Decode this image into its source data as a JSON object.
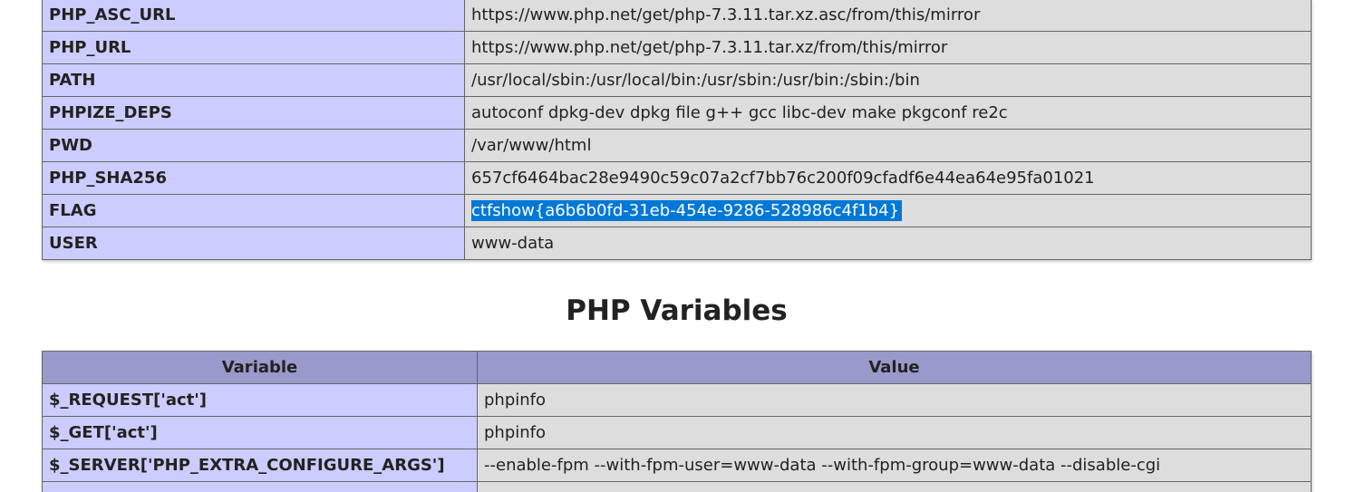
{
  "environment": {
    "rows": [
      {
        "name": "PHP_ASC_URL",
        "value": "https://www.php.net/get/php-7.3.11.tar.xz.asc/from/this/mirror"
      },
      {
        "name": "PHP_URL",
        "value": "https://www.php.net/get/php-7.3.11.tar.xz/from/this/mirror"
      },
      {
        "name": "PATH",
        "value": "/usr/local/sbin:/usr/local/bin:/usr/sbin:/usr/bin:/sbin:/bin"
      },
      {
        "name": "PHPIZE_DEPS",
        "value": "autoconf dpkg-dev dpkg file g++ gcc libc-dev make pkgconf re2c"
      },
      {
        "name": "PWD",
        "value": "/var/www/html"
      },
      {
        "name": "PHP_SHA256",
        "value": "657cf6464bac28e9490c59c07a2cf7bb76c200f09cfadf6e44ea64e95fa01021"
      },
      {
        "name": "FLAG",
        "value": "ctfshow{a6b6b0fd-31eb-454e-9286-528986c4f1b4}"
      },
      {
        "name": "USER",
        "value": "www-data"
      }
    ]
  },
  "php_variables": {
    "heading": "PHP Variables",
    "columns": {
      "variable": "Variable",
      "value": "Value"
    },
    "rows": [
      {
        "name": "$_REQUEST['act']",
        "value": "phpinfo"
      },
      {
        "name": "$_GET['act']",
        "value": "phpinfo"
      },
      {
        "name": "$_SERVER['PHP_EXTRA_CONFIGURE_ARGS']",
        "value": "--enable-fpm --with-fpm-user=www-data --with-fpm-group=www-data --disable-cgi"
      },
      {
        "name": "",
        "value": ""
      }
    ]
  },
  "colors": {
    "label_cell": "#ccccff",
    "value_cell": "#dddddd",
    "header_cell": "#9999cc",
    "selection": "#0078d7"
  }
}
